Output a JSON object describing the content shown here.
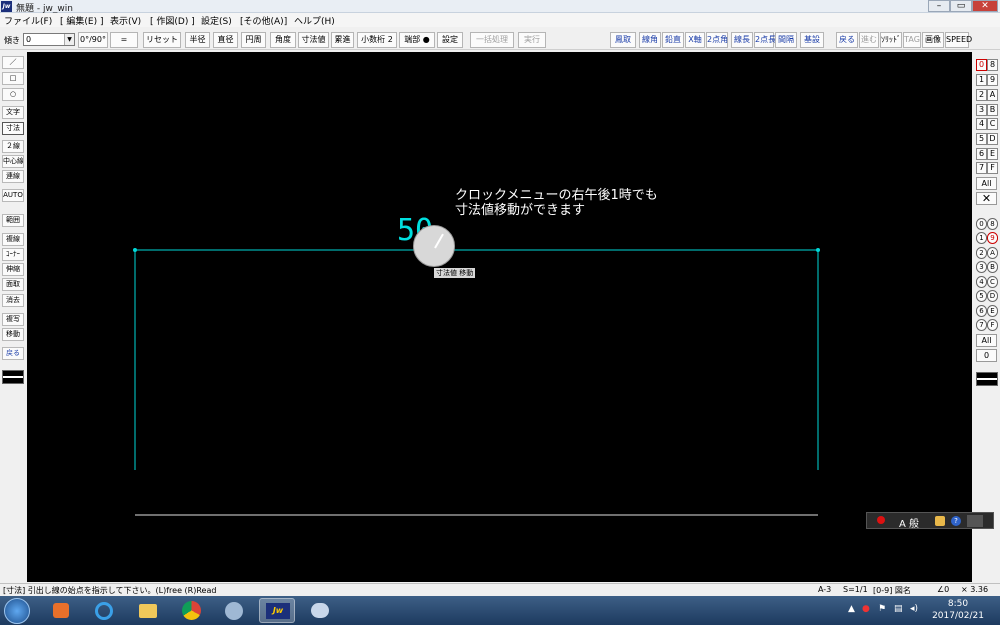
{
  "window": {
    "title": "無題 - jw_win",
    "app_icon": "Jw"
  },
  "menu": [
    "ファイル(F)",
    "[ 編集(E) ]",
    "表示(V)",
    "[ 作図(D) ]",
    "設定(S)",
    "[その他(A)]",
    "ヘルプ(H)"
  ],
  "toolbar": {
    "angle_label": "傾き",
    "angle_value": "0",
    "angle_toggle": "0°/90°",
    "equal": "=",
    "reset": "リセット",
    "radius": "半径",
    "diameter": "直径",
    "circumference": "円周",
    "angle": "角度",
    "dim_value": "寸法値",
    "cumulative": "累進",
    "decimals": "小数桁 2",
    "endpoint": "端部 ●",
    "settings": "設定",
    "batch": "一括処理",
    "execute": "実行",
    "right": [
      "鳳取",
      "線角",
      "鉛直",
      "X軸",
      "2点角",
      "線長",
      "2点長",
      "間隔",
      "基設",
      "戻る",
      "進む",
      "ｿﾘｯﾄﾞ",
      "TAG",
      "画像",
      "SPEED"
    ]
  },
  "left_tools": [
    "／",
    "□",
    "○",
    "文字",
    "寸法",
    "２線",
    "中心線",
    "連線",
    "AUTO",
    "範囲",
    "複線",
    "ｺｰﾅｰ",
    "伸縮",
    "面取",
    "消去",
    "複写",
    "移動",
    "戻る"
  ],
  "right_layers": {
    "groups": [
      "0",
      "1",
      "2",
      "3",
      "4",
      "5",
      "6",
      "7"
    ],
    "layers": [
      "8",
      "9",
      "A",
      "B",
      "C",
      "D",
      "E",
      "F"
    ],
    "all": "All",
    "circle_groups": [
      "0",
      "1",
      "2",
      "3",
      "4",
      "5",
      "6",
      "7"
    ],
    "circle_layers": [
      "8",
      "9",
      "A",
      "B",
      "C",
      "D",
      "E",
      "F"
    ],
    "all2": "All",
    "zero": "0"
  },
  "canvas": {
    "annotation_line1": "クロックメニューの右午後1時でも",
    "annotation_line2": "寸法値移動ができます",
    "dim_text": "50",
    "clock_label": "寸法値 移動"
  },
  "status": {
    "message": "[寸法] 引出し線の始点を指示して下さい。(L)free (R)Read",
    "paper": "A-3",
    "scale": "S=1/1",
    "layer": "[0-9] 図名",
    "angle": "∠0",
    "zoom": "× 3.36"
  },
  "ime": {
    "mode": "A 般"
  },
  "clock": {
    "time": "8:50",
    "date": "2017/02/21"
  },
  "colors": {
    "canvas_bg": "#000000",
    "cyan": "#00e0e0",
    "line": "#ffffff"
  }
}
